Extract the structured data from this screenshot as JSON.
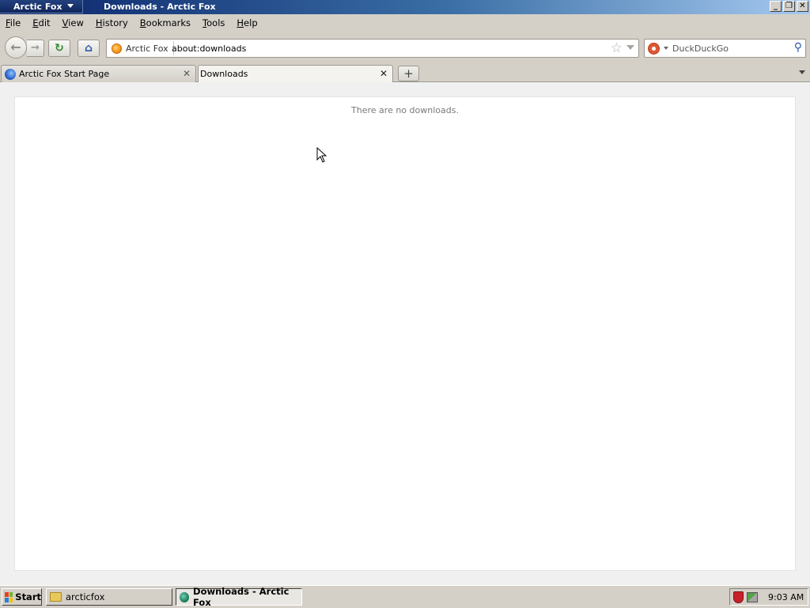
{
  "titlebar": {
    "app_menu_label": "Arctic Fox",
    "window_title": "Downloads - Arctic Fox",
    "minimize": "_",
    "restore": "❐",
    "close": "✕"
  },
  "menu": {
    "items": [
      {
        "underline": "F",
        "rest": "ile"
      },
      {
        "underline": "E",
        "rest": "dit"
      },
      {
        "underline": "V",
        "rest": "iew"
      },
      {
        "underline": "H",
        "rest": "istory"
      },
      {
        "underline": "B",
        "rest": "ookmarks"
      },
      {
        "underline": "T",
        "rest": "ools"
      },
      {
        "underline": "H",
        "rest": "elp"
      }
    ]
  },
  "navbar": {
    "back_glyph": "←",
    "forward_glyph": "→",
    "reload_glyph": "↻",
    "home_glyph": "⌂",
    "identity_label": "Arctic Fox",
    "url": "about:downloads",
    "bookmark_star": "☆",
    "search_engine": "DuckDuckGo",
    "search_glyph": "⚲"
  },
  "tabs": [
    {
      "label": "Arctic Fox Start Page",
      "active": false
    },
    {
      "label": "Downloads",
      "active": true
    }
  ],
  "tab_close_glyph": "✕",
  "new_tab_glyph": "+",
  "content": {
    "empty_message": "There are no downloads."
  },
  "taskbar": {
    "start_label": "Start",
    "tasks": [
      {
        "label": "arcticfox",
        "icon": "folder-icon",
        "active": false
      },
      {
        "label": "Downloads - Arctic Fox",
        "icon": "arctic-fox-icon",
        "active": true
      }
    ],
    "clock": "9:03 AM"
  },
  "colors": {
    "titlebar_start": "#0a246a",
    "content_bg": "#f0f0f0",
    "panel_bg": "#ffffff"
  }
}
